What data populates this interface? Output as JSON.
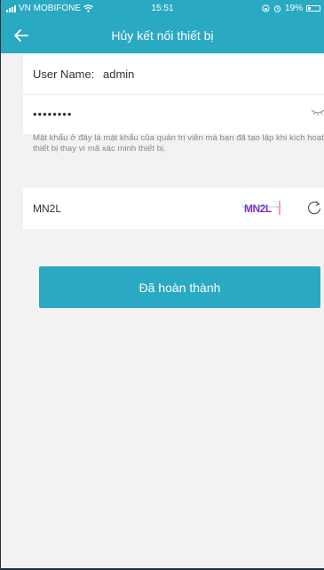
{
  "status_bar": {
    "carrier": "VN MOBIFONE",
    "time": "15:51",
    "battery": "19%"
  },
  "header": {
    "title": "Hủy kết nối thiết bị"
  },
  "form": {
    "username_label": "User Name:",
    "username_value": "admin",
    "password_mask": "••••••••",
    "hint": "Mật khẩu ở đây là mật khẩu của quản trị viên mà bạn đã tạo lập khi kích hoạt thiết bị thay vì mã xác minh thiết bị.",
    "captcha_value": "MN2L",
    "captcha_image_text": "MN2L"
  },
  "actions": {
    "done_label": "Đã hoàn thành"
  },
  "colors": {
    "accent": "#2aa9c2",
    "background": "#f2f2f2"
  }
}
